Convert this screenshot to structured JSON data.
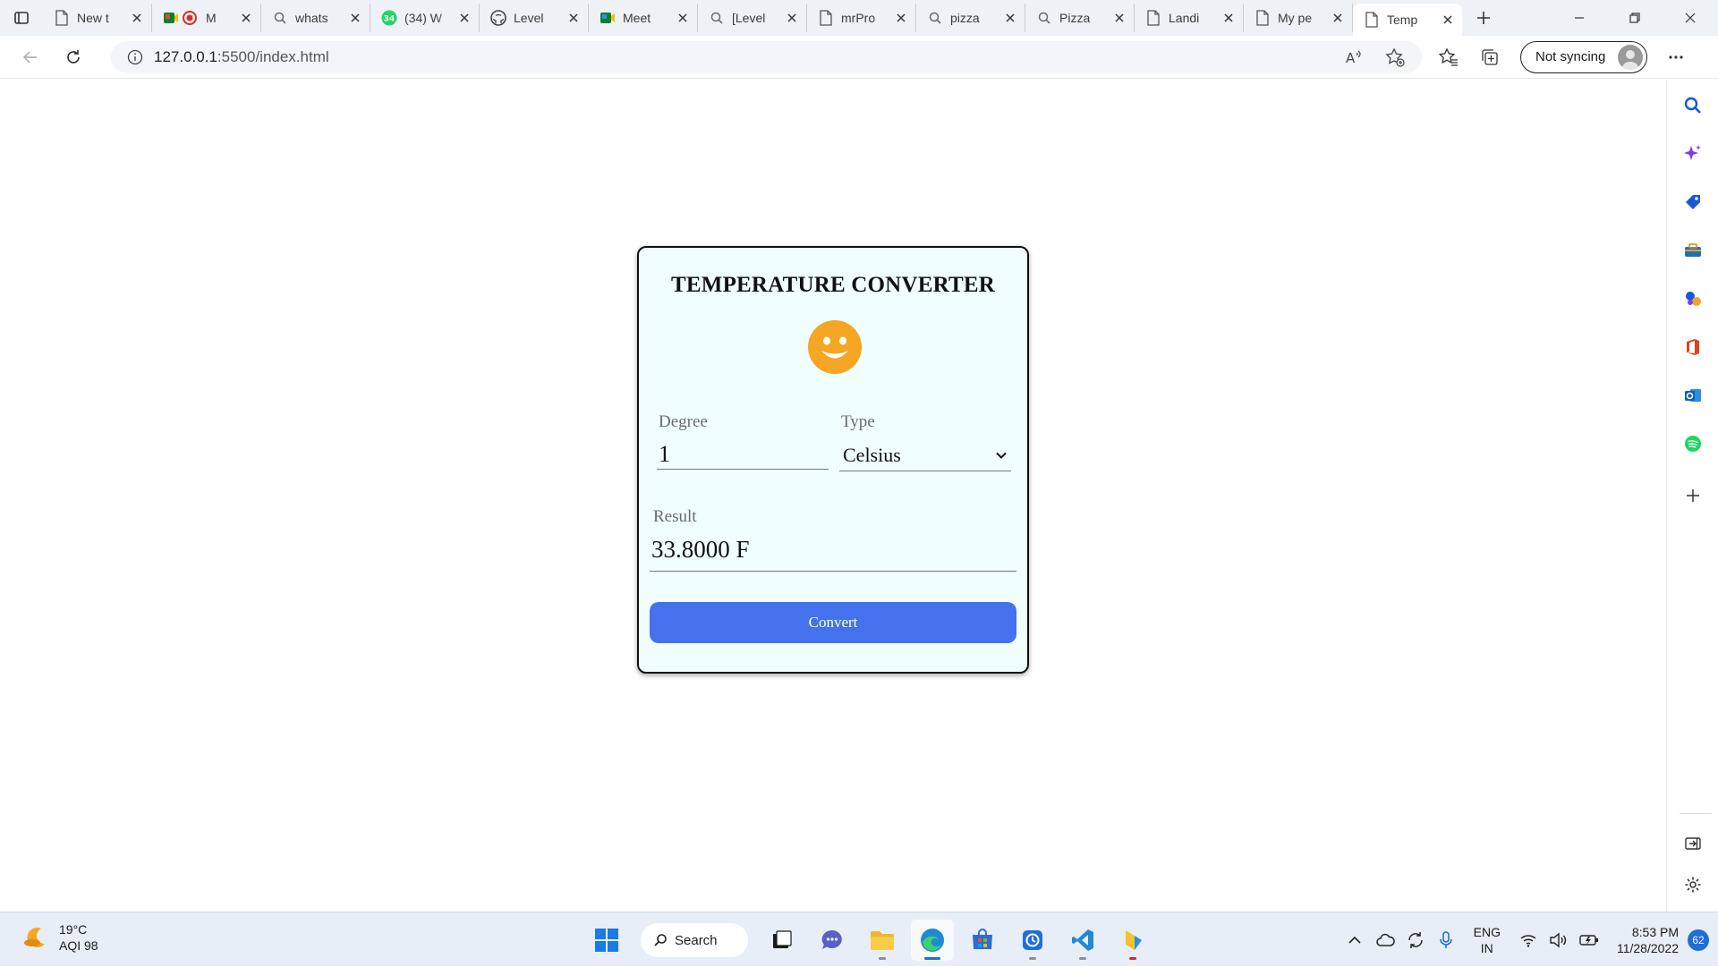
{
  "browser": {
    "tabs": [
      {
        "title": "New t",
        "favicon": "page-icon"
      },
      {
        "title": "M",
        "favicon": "meet-record-icon"
      },
      {
        "title": "whats",
        "favicon": "search-icon"
      },
      {
        "title": "(34) W",
        "favicon": "whatsapp-icon",
        "badge": "34"
      },
      {
        "title": "Level",
        "favicon": "github-icon"
      },
      {
        "title": "Meet",
        "favicon": "meet-icon"
      },
      {
        "title": "[Level",
        "favicon": "search-icon"
      },
      {
        "title": "mrPro",
        "favicon": "page-icon"
      },
      {
        "title": "pizza",
        "favicon": "search-icon"
      },
      {
        "title": "Pizza",
        "favicon": "search-icon"
      },
      {
        "title": "Landi",
        "favicon": "page-icon"
      },
      {
        "title": "My pe",
        "favicon": "page-icon"
      },
      {
        "title": "Temp",
        "favicon": "page-icon",
        "active": true
      }
    ],
    "address": {
      "host": "127.0.0.1",
      "path": ":5500/index.html"
    },
    "sync_label": "Not syncing"
  },
  "app": {
    "title": "TEMPERATURE CONVERTER",
    "degree_label": "Degree",
    "degree_value": "1",
    "type_label": "Type",
    "type_value": "Celsius",
    "result_label": "Result",
    "result_value": "33.8000 F",
    "convert_label": "Convert",
    "colors": {
      "card_bg": "#f0fffe",
      "button": "#4471ec",
      "smiley": "#f5a623"
    }
  },
  "taskbar": {
    "weather_temp": "19°C",
    "weather_aqi": "AQI 98",
    "search_label": "Search",
    "lang_top": "ENG",
    "lang_bottom": "IN",
    "time": "8:53 PM",
    "date": "11/28/2022",
    "notification_count": "62"
  }
}
